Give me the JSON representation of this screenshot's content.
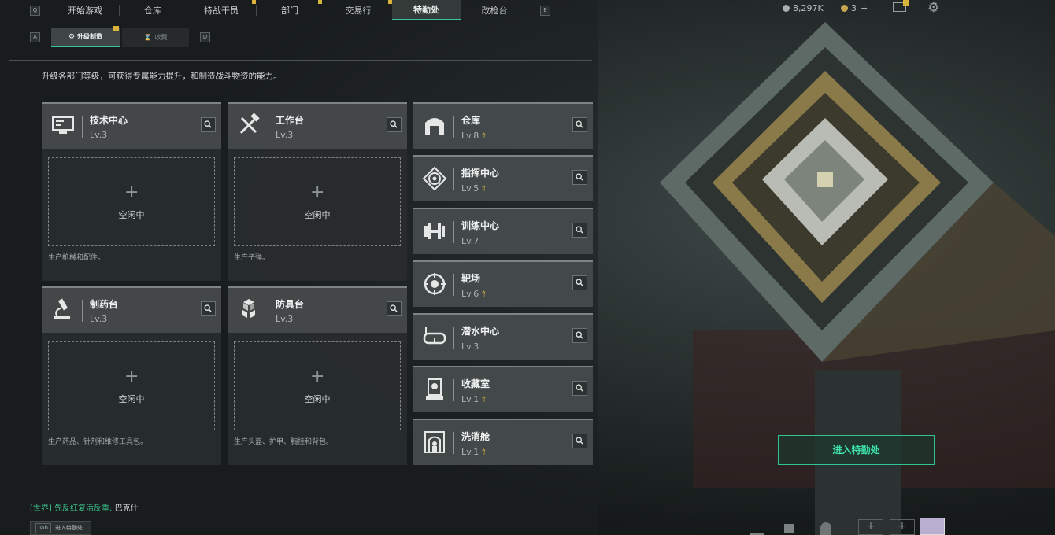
{
  "top_nav": {
    "left_key": "Q",
    "right_key": "E",
    "tabs": [
      "开始游戏",
      "仓库",
      "特战干员",
      "部门",
      "交易行",
      "特勤处",
      "改枪台"
    ],
    "active_tab": "特勤处",
    "currency_amount": "8,297K",
    "currency2_amount": "3",
    "currency2_add": "+"
  },
  "sub_nav": {
    "left_key": "A",
    "right_key": "D",
    "tabs": [
      "升级制造",
      "收藏"
    ],
    "active_tab": "升级制造"
  },
  "description": "升级各部门等级，可获得专属能力提升，和制造战斗物资的能力。",
  "production_cards": [
    {
      "name": "技术中心",
      "level": "Lv.3",
      "slot_status": "空闲中",
      "desc": "生产枪械和配件。",
      "icon": "computer-icon"
    },
    {
      "name": "工作台",
      "level": "Lv.3",
      "slot_status": "空闲中",
      "desc": "生产子弹。",
      "icon": "tools-icon"
    },
    {
      "name": "制药台",
      "level": "Lv.3",
      "slot_status": "空闲中",
      "desc": "生产药品、针剂和维修工具包。",
      "icon": "microscope-icon"
    },
    {
      "name": "防具台",
      "level": "Lv.3",
      "slot_status": "空闲中",
      "desc": "生产头盔、护甲、胸挂和背包。",
      "icon": "armor-cubes-icon"
    }
  ],
  "departments": [
    {
      "name": "仓库",
      "level": "Lv.8",
      "upgradable": true,
      "icon": "warehouse-icon"
    },
    {
      "name": "指挥中心",
      "level": "Lv.5",
      "upgradable": true,
      "icon": "command-icon"
    },
    {
      "name": "训练中心",
      "level": "Lv.7",
      "upgradable": false,
      "icon": "dumbbell-icon"
    },
    {
      "name": "靶场",
      "level": "Lv.6",
      "upgradable": true,
      "icon": "target-icon"
    },
    {
      "name": "潜水中心",
      "level": "Lv.3",
      "upgradable": false,
      "icon": "dive-mask-icon"
    },
    {
      "name": "收藏室",
      "level": "Lv.1",
      "upgradable": true,
      "icon": "collection-icon"
    },
    {
      "name": "洗消舱",
      "level": "Lv.1",
      "upgradable": true,
      "icon": "decontamination-icon"
    }
  ],
  "enter_button": "进入特勤处",
  "chat": {
    "channel": "[世界]",
    "sender": "先反红复活反重:",
    "message": "巴克什"
  },
  "hint": {
    "key": "Tab",
    "label": "进入特勤处"
  },
  "colors": {
    "accent": "#38c79b",
    "upgrade": "#d8b444",
    "panel": "#44494a"
  }
}
